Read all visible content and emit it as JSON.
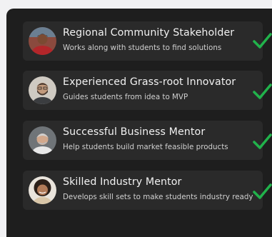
{
  "mentors": [
    {
      "title": "Regional Community Stakeholder",
      "subtitle": "Works along with students to find solutions",
      "avatar_icon": "person-red-jacket-avatar",
      "avatar_bg": "#8a4a3e"
    },
    {
      "title": "Experienced Grass-root Innovator",
      "subtitle": "Guides students from idea to MVP",
      "avatar_icon": "person-glasses-beard-avatar",
      "avatar_bg": "#cfcac2"
    },
    {
      "title": "Successful Business Mentor",
      "subtitle": "Help students build market feasible products",
      "avatar_icon": "person-grey-hair-avatar",
      "avatar_bg": "#6f7478"
    },
    {
      "title": "Skilled Industry Mentor",
      "subtitle": "Develops skill sets to make students industry ready",
      "avatar_icon": "person-curly-hair-avatar",
      "avatar_bg": "#e9e4dc"
    }
  ],
  "colors": {
    "panel_bg": "#1e1e1e",
    "card_bg": "#2a2a2a",
    "check": "#21b24b"
  }
}
